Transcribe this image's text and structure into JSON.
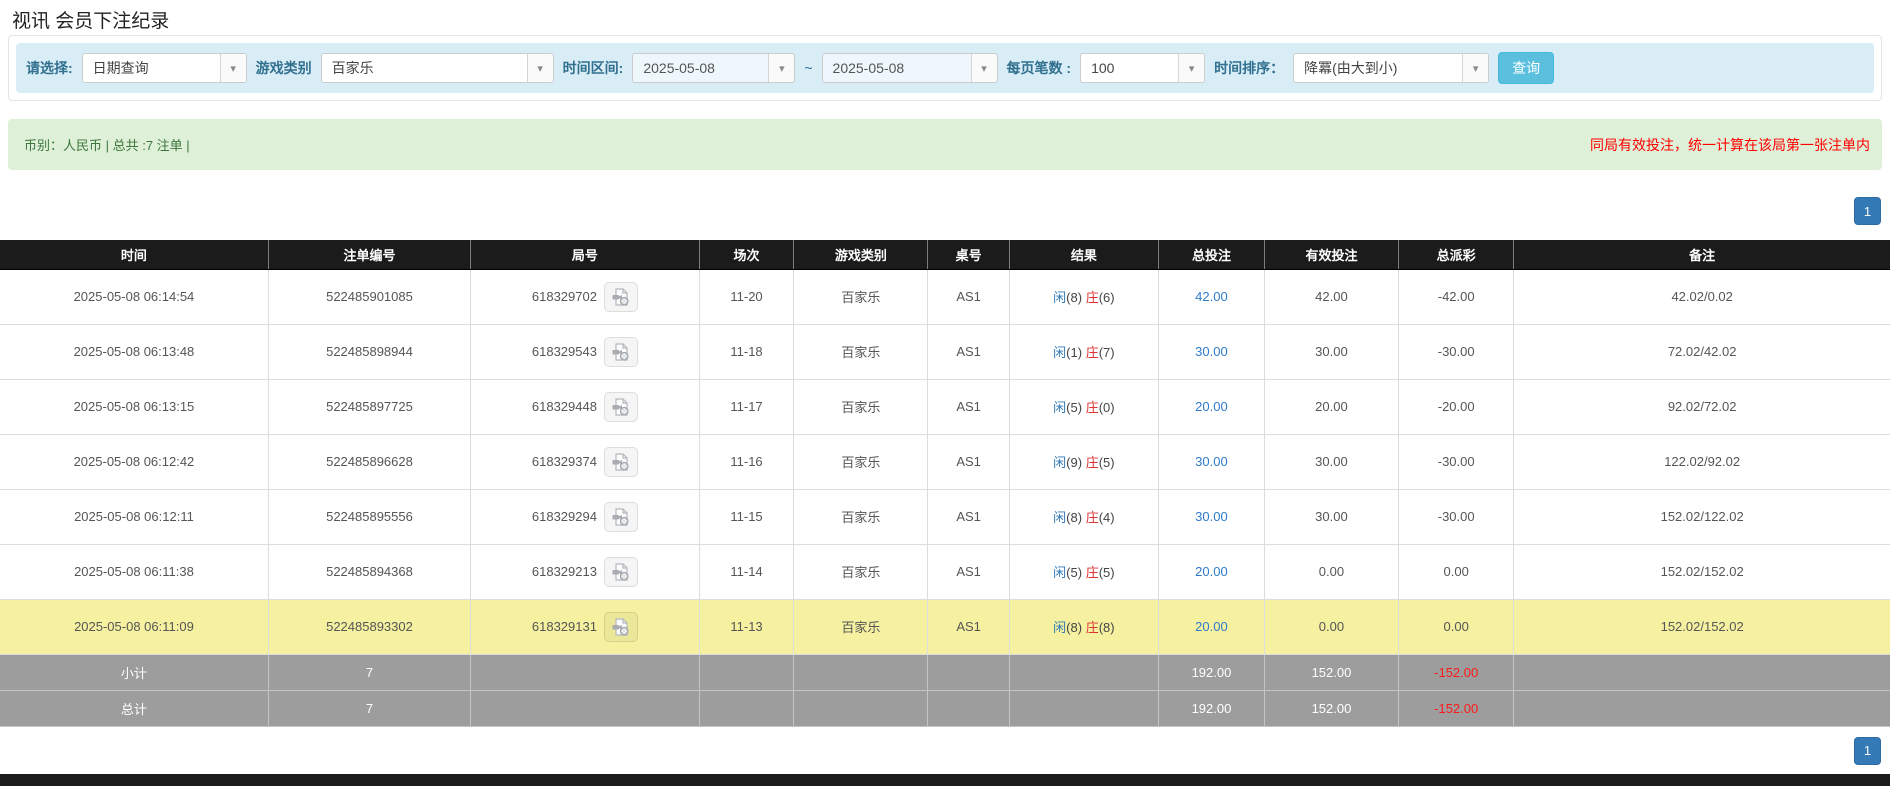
{
  "page_title": "视讯 会员下注纪录",
  "filters": {
    "select_label": "请选择:",
    "select_value": "日期查询",
    "game_type_label": "游戏类别",
    "game_type_value": "百家乐",
    "time_range_label": "时间区间:",
    "date_from": "2025-05-08",
    "date_separator": "~",
    "date_to": "2025-05-08",
    "page_size_label": "每页笔数 :",
    "page_size_value": "100",
    "sort_label": "时间排序：",
    "sort_value": "降冪(由大到小)",
    "search_button": "查询",
    "dropdown_arrow_glyph": "▾"
  },
  "notice_bar": {
    "left_text": "币别：人民币 | 总共 :7 注单 |",
    "right_text": "同局有效投注，统一计算在该局第一张注单内"
  },
  "pagination": {
    "page": "1"
  },
  "table": {
    "headers": [
      "时间",
      "注单编号",
      "局号",
      "场次",
      "游戏类别",
      "桌号",
      "结果",
      "总投注",
      "有效投注",
      "总派彩",
      "备注"
    ],
    "result_labels": {
      "player": "闲",
      "banker": "庄"
    },
    "rows": [
      {
        "time": "2025-05-08 06:14:54",
        "bet_id": "522485901085",
        "round_id": "618329702",
        "session": "11-20",
        "game": "百家乐",
        "table_no": "AS1",
        "player": "8",
        "banker": "6",
        "total_bet": "42.00",
        "valid_bet": "42.00",
        "payout": "-42.00",
        "payout_negative": true,
        "remark": "42.02/0.02",
        "highlight": false
      },
      {
        "time": "2025-05-08 06:13:48",
        "bet_id": "522485898944",
        "round_id": "618329543",
        "session": "11-18",
        "game": "百家乐",
        "table_no": "AS1",
        "player": "1",
        "banker": "7",
        "total_bet": "30.00",
        "valid_bet": "30.00",
        "payout": "-30.00",
        "payout_negative": true,
        "remark": "72.02/42.02",
        "highlight": false
      },
      {
        "time": "2025-05-08 06:13:15",
        "bet_id": "522485897725",
        "round_id": "618329448",
        "session": "11-17",
        "game": "百家乐",
        "table_no": "AS1",
        "player": "5",
        "banker": "0",
        "total_bet": "20.00",
        "valid_bet": "20.00",
        "payout": "-20.00",
        "payout_negative": true,
        "remark": "92.02/72.02",
        "highlight": false
      },
      {
        "time": "2025-05-08 06:12:42",
        "bet_id": "522485896628",
        "round_id": "618329374",
        "session": "11-16",
        "game": "百家乐",
        "table_no": "AS1",
        "player": "9",
        "banker": "5",
        "total_bet": "30.00",
        "valid_bet": "30.00",
        "payout": "-30.00",
        "payout_negative": true,
        "remark": "122.02/92.02",
        "highlight": false
      },
      {
        "time": "2025-05-08 06:12:11",
        "bet_id": "522485895556",
        "round_id": "618329294",
        "session": "11-15",
        "game": "百家乐",
        "table_no": "AS1",
        "player": "8",
        "banker": "4",
        "total_bet": "30.00",
        "valid_bet": "30.00",
        "payout": "-30.00",
        "payout_negative": true,
        "remark": "152.02/122.02",
        "highlight": false
      },
      {
        "time": "2025-05-08 06:11:38",
        "bet_id": "522485894368",
        "round_id": "618329213",
        "session": "11-14",
        "game": "百家乐",
        "table_no": "AS1",
        "player": "5",
        "banker": "5",
        "total_bet": "20.00",
        "valid_bet": "0.00",
        "payout": "0.00",
        "payout_negative": false,
        "remark": "152.02/152.02",
        "highlight": false
      },
      {
        "time": "2025-05-08 06:11:09",
        "bet_id": "522485893302",
        "round_id": "618329131",
        "session": "11-13",
        "game": "百家乐",
        "table_no": "AS1",
        "player": "8",
        "banker": "8",
        "total_bet": "20.00",
        "valid_bet": "0.00",
        "payout": "0.00",
        "payout_negative": false,
        "remark": "152.02/152.02",
        "highlight": true
      }
    ],
    "subtotal": {
      "label": "小计",
      "count": "7",
      "total_bet": "192.00",
      "valid_bet": "152.00",
      "payout": "-152.00"
    },
    "total": {
      "label": "总计",
      "count": "7",
      "total_bet": "192.00",
      "valid_bet": "152.00",
      "payout": "-152.00"
    }
  },
  "colors": {
    "filter_bar_bg": "#d9edf7",
    "search_button": "#5bc0de",
    "notice_bg": "#dff0d8",
    "notice_text": "#3c763d",
    "notice_warning": "#ff0000",
    "pagination_blue": "#337ab7",
    "table_header_bg": "#1b1b1b",
    "highlight_row": "#f5f1a0",
    "link_blue": "#2e7bcc",
    "negative_red": "#e60000",
    "player_blue": "#337ab7",
    "banker_red": "#dd3333",
    "summary_row_bg": "#9d9d9d"
  }
}
